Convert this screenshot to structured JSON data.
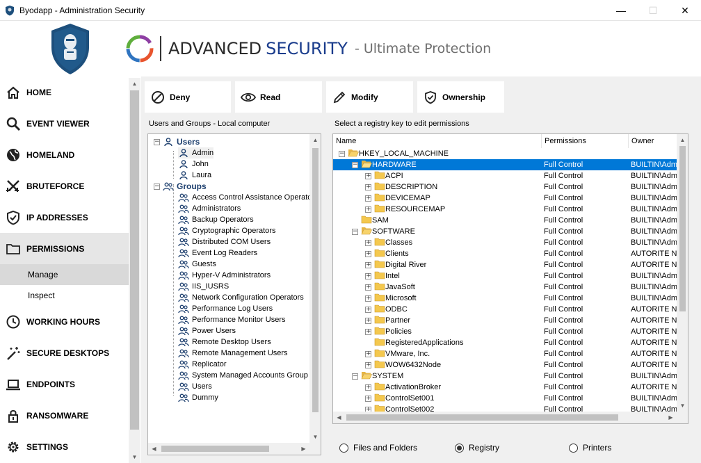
{
  "window": {
    "title": "Byodapp - Administration Security",
    "controls": {
      "minimize": "—",
      "maximize": "☐",
      "close": "✕"
    }
  },
  "brand": {
    "advanced": "ADVANCED",
    "security": "SECURITY",
    "tagline": "- Ultimate Protection",
    "colors": {
      "accent": "#1a3c8c",
      "shield": "#1d4f7c"
    }
  },
  "sidebar": {
    "items": [
      {
        "label": "HOME",
        "icon": "home-icon"
      },
      {
        "label": "EVENT VIEWER",
        "icon": "search-icon"
      },
      {
        "label": "HOMELAND",
        "icon": "globe-icon"
      },
      {
        "label": "BRUTEFORCE",
        "icon": "crossed-swords-icon"
      },
      {
        "label": "IP ADDRESSES",
        "icon": "shield-check-icon"
      },
      {
        "label": "PERMISSIONS",
        "icon": "folder-icon",
        "active": true
      },
      {
        "label": "WORKING HOURS",
        "icon": "clock-icon"
      },
      {
        "label": "SECURE DESKTOPS",
        "icon": "magic-wand-icon"
      },
      {
        "label": "ENDPOINTS",
        "icon": "laptop-icon"
      },
      {
        "label": "RANSOMWARE",
        "icon": "lock-icon"
      },
      {
        "label": "SETTINGS",
        "icon": "gear-icon"
      }
    ],
    "permissions_sub": [
      {
        "label": "Manage",
        "active": true
      },
      {
        "label": "Inspect"
      }
    ]
  },
  "toolbar": {
    "deny": "Deny",
    "read": "Read",
    "modify": "Modify",
    "ownership": "Ownership"
  },
  "users_panel": {
    "label": "Users and Groups - Local computer",
    "users_header": "Users",
    "users": [
      "Admin",
      "John",
      "Laura"
    ],
    "groups_header": "Groups",
    "groups": [
      "Access Control Assistance Operators",
      "Administrators",
      "Backup Operators",
      "Cryptographic Operators",
      "Distributed COM Users",
      "Event Log Readers",
      "Guests",
      "Hyper-V Administrators",
      "IIS_IUSRS",
      "Network Configuration Operators",
      "Performance Log Users",
      "Performance Monitor Users",
      "Power Users",
      "Remote Desktop Users",
      "Remote Management Users",
      "Replicator",
      "System Managed Accounts Group",
      "Users",
      "Dummy"
    ]
  },
  "registry_panel": {
    "label": "Select a registry key to edit permissions",
    "columns": [
      "Name",
      "Permissions",
      "Owner"
    ],
    "rows": [
      {
        "name": "HKEY_LOCAL_MACHINE",
        "perm": "",
        "owner": "",
        "level": 0,
        "exp": "−"
      },
      {
        "name": "HARDWARE",
        "perm": "Full Control",
        "owner": "BUILTIN\\Administrators",
        "level": 1,
        "exp": "−",
        "selected": true
      },
      {
        "name": "ACPI",
        "perm": "Full Control",
        "owner": "BUILTIN\\Administrators",
        "level": 2,
        "exp": "+"
      },
      {
        "name": "DESCRIPTION",
        "perm": "Full Control",
        "owner": "BUILTIN\\Administrators",
        "level": 2,
        "exp": "+"
      },
      {
        "name": "DEVICEMAP",
        "perm": "Full Control",
        "owner": "BUILTIN\\Administrators",
        "level": 2,
        "exp": "+"
      },
      {
        "name": "RESOURCEMAP",
        "perm": "Full Control",
        "owner": "BUILTIN\\Administrators",
        "level": 2,
        "exp": "+"
      },
      {
        "name": "SAM",
        "perm": "Full Control",
        "owner": "BUILTIN\\Administrators",
        "level": 1,
        "exp": ""
      },
      {
        "name": "SOFTWARE",
        "perm": "Full Control",
        "owner": "BUILTIN\\Administrators",
        "level": 1,
        "exp": "−"
      },
      {
        "name": "Classes",
        "perm": "Full Control",
        "owner": "BUILTIN\\Administrators",
        "level": 2,
        "exp": "+"
      },
      {
        "name": "Clients",
        "perm": "Full Control",
        "owner": "AUTORITE NT\\Système",
        "level": 2,
        "exp": "+"
      },
      {
        "name": "Digital River",
        "perm": "Full Control",
        "owner": "AUTORITE NT\\Système",
        "level": 2,
        "exp": "+"
      },
      {
        "name": "Intel",
        "perm": "Full Control",
        "owner": "BUILTIN\\Administrators",
        "level": 2,
        "exp": "+"
      },
      {
        "name": "JavaSoft",
        "perm": "Full Control",
        "owner": "BUILTIN\\Administrators",
        "level": 2,
        "exp": "+"
      },
      {
        "name": "Microsoft",
        "perm": "Full Control",
        "owner": "BUILTIN\\Administrators",
        "level": 2,
        "exp": "+"
      },
      {
        "name": "ODBC",
        "perm": "Full Control",
        "owner": "AUTORITE NT\\Système",
        "level": 2,
        "exp": "+"
      },
      {
        "name": "Partner",
        "perm": "Full Control",
        "owner": "AUTORITE NT\\Système",
        "level": 2,
        "exp": "+"
      },
      {
        "name": "Policies",
        "perm": "Full Control",
        "owner": "AUTORITE NT\\Système",
        "level": 2,
        "exp": "+"
      },
      {
        "name": "RegisteredApplications",
        "perm": "Full Control",
        "owner": "AUTORITE NT\\Système",
        "level": 2,
        "exp": ""
      },
      {
        "name": "VMware, Inc.",
        "perm": "Full Control",
        "owner": "AUTORITE NT\\Système",
        "level": 2,
        "exp": "+"
      },
      {
        "name": "WOW6432Node",
        "perm": "Full Control",
        "owner": "AUTORITE NT\\Système",
        "level": 2,
        "exp": "+"
      },
      {
        "name": "SYSTEM",
        "perm": "Full Control",
        "owner": "BUILTIN\\Administrators",
        "level": 1,
        "exp": "−"
      },
      {
        "name": "ActivationBroker",
        "perm": "Full Control",
        "owner": "AUTORITE NT\\Système",
        "level": 2,
        "exp": "+"
      },
      {
        "name": "ControlSet001",
        "perm": "Full Control",
        "owner": "BUILTIN\\Administrators",
        "level": 2,
        "exp": "+"
      },
      {
        "name": "ControlSet002",
        "perm": "Full Control",
        "owner": "BUILTIN\\Administrators",
        "level": 2,
        "exp": "+"
      }
    ]
  },
  "source_options": [
    {
      "label": "Files and Folders",
      "checked": false
    },
    {
      "label": "Registry",
      "checked": true
    },
    {
      "label": "Printers",
      "checked": false
    }
  ]
}
